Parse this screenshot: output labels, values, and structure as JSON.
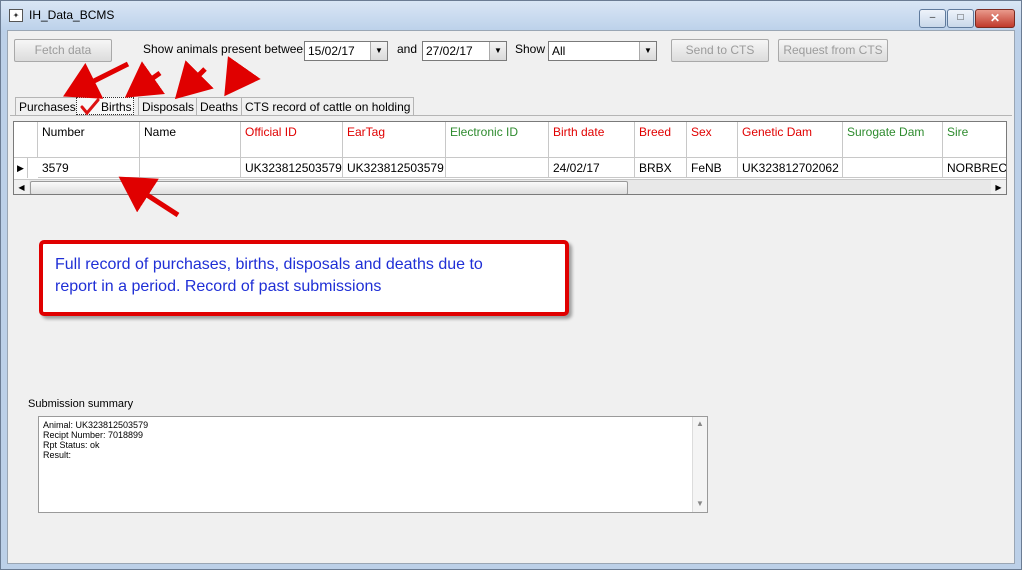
{
  "window": {
    "title": "IH_Data_BCMS",
    "min_glyph": "–",
    "max_glyph": "□",
    "close_glyph": "✕"
  },
  "toolbar": {
    "fetch_label": "Fetch data",
    "show_between_label": "Show animals present between",
    "date_from": "15/02/17",
    "and_label": "and",
    "date_to": "27/02/17",
    "show_label": "Show",
    "show_value": "All",
    "send_label": "Send to CTS",
    "request_label": "Request from CTS"
  },
  "tabs": [
    {
      "label": "Purchases"
    },
    {
      "label": "Births",
      "active": true
    },
    {
      "label": "Disposals"
    },
    {
      "label": "Deaths"
    },
    {
      "label": "CTS record of cattle on holding"
    }
  ],
  "grid": {
    "columns": [
      {
        "label": "Number",
        "color": "#000000"
      },
      {
        "label": "Name",
        "color": "#000000"
      },
      {
        "label": "Official ID",
        "color": "#e00000"
      },
      {
        "label": "EarTag",
        "color": "#e00000"
      },
      {
        "label": "Electronic ID",
        "color": "#2e8b2e"
      },
      {
        "label": "Birth date",
        "color": "#e00000"
      },
      {
        "label": "Breed",
        "color": "#e00000"
      },
      {
        "label": "Sex",
        "color": "#e00000"
      },
      {
        "label": "Genetic Dam",
        "color": "#e00000"
      },
      {
        "label": "Surogate Dam",
        "color": "#2e8b2e"
      },
      {
        "label": "Sire",
        "color": "#2e8b2e"
      }
    ],
    "rows": [
      [
        "3579",
        "",
        "UK323812503579",
        "UK323812503579",
        "",
        "24/02/17",
        "BRBX",
        "FeNB",
        "UK323812702062",
        "",
        "NORBREC"
      ]
    ]
  },
  "callout": {
    "line1": "Full record of purchases, births, disposals and deaths  due to",
    "line2": "report in a period.  Record of past submissions"
  },
  "summary": {
    "label": "Submission summary",
    "lines": [
      "Animal:  UK323812503579",
      "Recipt Number:  7018899",
      "Rpt Status:  ok",
      "Result:"
    ]
  },
  "colors": {
    "accent_red": "#e00000",
    "callout_text": "#1f2fd6",
    "optional_green": "#2e8b2e"
  }
}
